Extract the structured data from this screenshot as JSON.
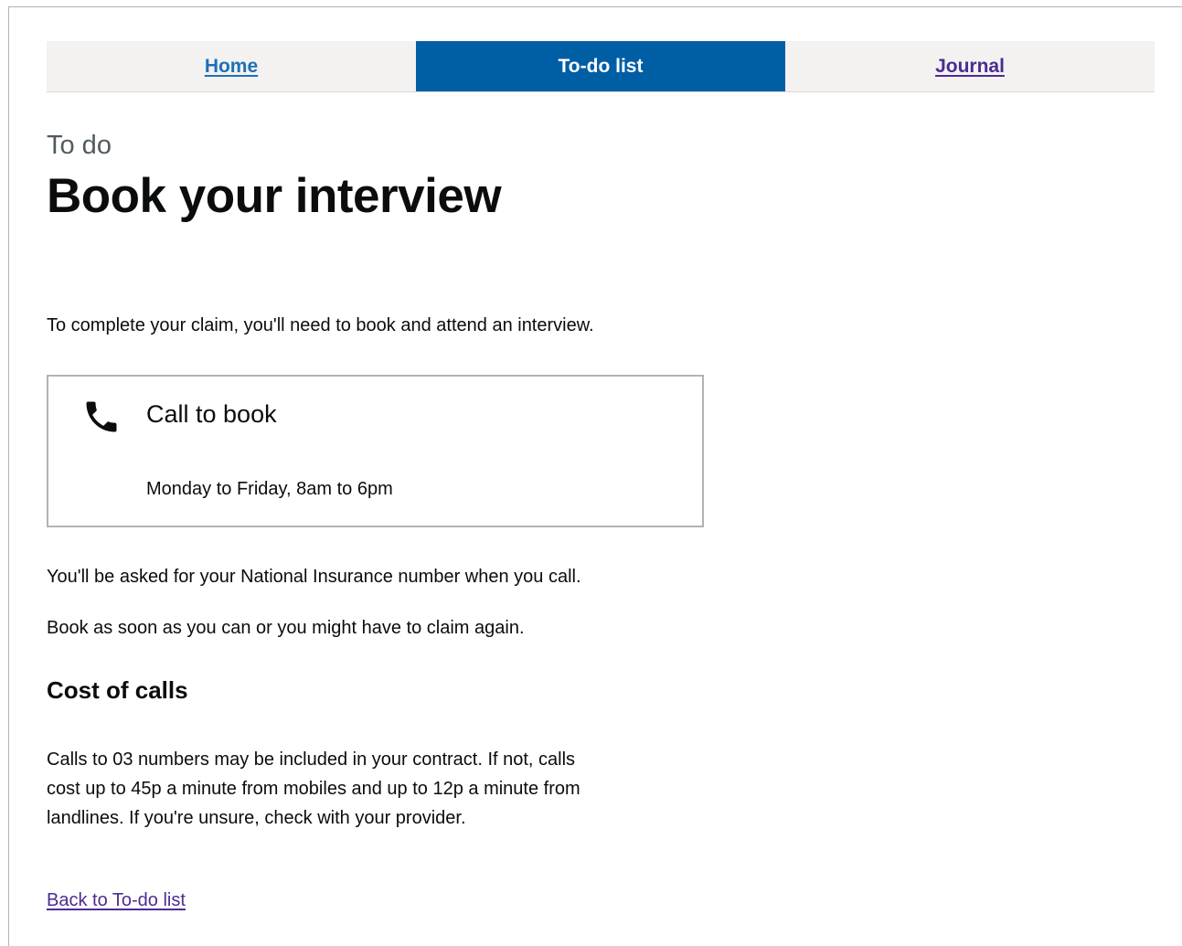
{
  "nav": {
    "tabs": [
      {
        "label": "Home",
        "state": "link"
      },
      {
        "label": "To-do list",
        "state": "active"
      },
      {
        "label": "Journal",
        "state": "visited"
      }
    ]
  },
  "page": {
    "caption": "To do",
    "title": "Book your interview",
    "intro": "To complete your claim, you'll need to book and attend an interview."
  },
  "call_box": {
    "icon": "phone-icon",
    "title": "Call to book",
    "hours": "Monday to Friday, 8am to 6pm"
  },
  "info": {
    "ni_note": "You'll be asked for your National Insurance number when you call.",
    "book_note": "Book as soon as you can or you might have to claim again."
  },
  "cost": {
    "heading": "Cost of calls",
    "line1": "Calls to 03 numbers may be included in your contract. If not, calls",
    "line2": "cost up to 45p a minute from mobiles and up to 12p a minute from",
    "line3": "landlines. If you're unsure, check with your provider."
  },
  "back_link": "Back to To-do list",
  "colors": {
    "active_tab": "#005ea5",
    "link": "#1d70b8",
    "visited_link": "#4c2c92"
  }
}
